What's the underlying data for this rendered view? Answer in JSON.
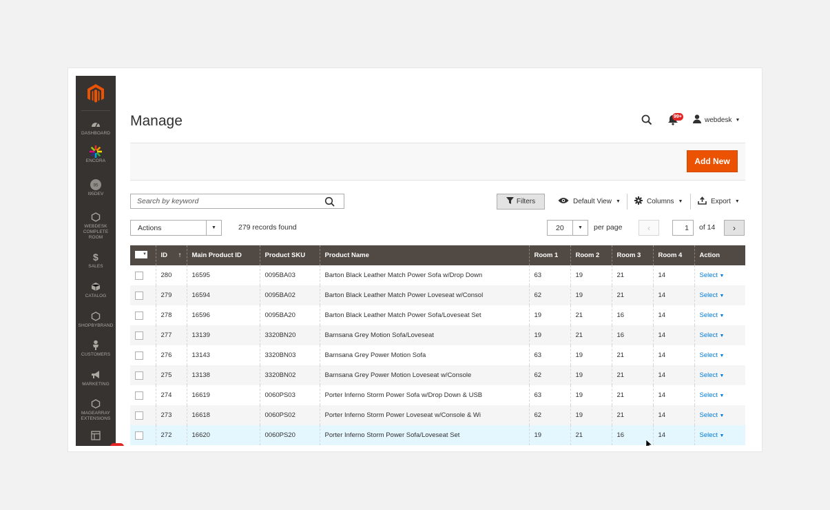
{
  "sidebar": {
    "items": [
      {
        "label": "DASHBOARD",
        "icon": "dashboard-icon"
      },
      {
        "label": "ENCORA",
        "icon": "encora-icon"
      },
      {
        "label": "I95DEV",
        "icon": "i95dev-icon"
      },
      {
        "label": "WEBDESK COMPLETE ROOM",
        "icon": "hexagon-icon"
      },
      {
        "label": "SALES",
        "icon": "dollar-icon"
      },
      {
        "label": "CATALOG",
        "icon": "cube-icon"
      },
      {
        "label": "SHOPBYBRAND",
        "icon": "hexagon-icon"
      },
      {
        "label": "CUSTOMERS",
        "icon": "person-icon"
      },
      {
        "label": "MARKETING",
        "icon": "megaphone-icon"
      },
      {
        "label": "MAGEARRAY EXTENSIONS",
        "icon": "hexagon-icon"
      },
      {
        "label": "",
        "icon": "layout-icon"
      }
    ]
  },
  "header": {
    "title": "Manage",
    "notification_count": "99+",
    "user": "webdesk"
  },
  "action_bar": {
    "add_new": "Add New"
  },
  "toolbar": {
    "search_placeholder": "Search by keyword",
    "filters": "Filters",
    "view": "Default View",
    "columns": "Columns",
    "export": "Export",
    "actions": "Actions",
    "records": "279 records found",
    "per_page_value": "20",
    "per_page_label": "per page",
    "page": "1",
    "page_of": "of 14"
  },
  "table": {
    "columns": [
      "ID",
      "Main Product ID",
      "Product SKU",
      "Product Name",
      "Room 1",
      "Room 2",
      "Room 3",
      "Room 4",
      "Action"
    ],
    "rows": [
      [
        "280",
        "16595",
        "0095BA03",
        "Barton Black Leather Match Power Sofa w/Drop Down",
        "63",
        "19",
        "21",
        "14",
        "Select"
      ],
      [
        "279",
        "16594",
        "0095BA02",
        "Barton Black Leather Match Power Loveseat w/Consol",
        "62",
        "19",
        "21",
        "14",
        "Select"
      ],
      [
        "278",
        "16596",
        "0095BA20",
        "Barton Black Leather Match Power Sofa/Loveseat Set",
        "19",
        "21",
        "16",
        "14",
        "Select"
      ],
      [
        "277",
        "13139",
        "3320BN20",
        "Barnsana Grey Motion Sofa/Loveseat",
        "19",
        "21",
        "16",
        "14",
        "Select"
      ],
      [
        "276",
        "13143",
        "3320BN03",
        "Barnsana Grey Power Motion Sofa",
        "63",
        "19",
        "21",
        "14",
        "Select"
      ],
      [
        "275",
        "13138",
        "3320BN02",
        "Barnsana Grey Power Motion Loveseat w/Console",
        "62",
        "19",
        "21",
        "14",
        "Select"
      ],
      [
        "274",
        "16619",
        "0060PS03",
        "Porter Inferno Storm Power Sofa w/Drop Down & USB",
        "63",
        "19",
        "21",
        "14",
        "Select"
      ],
      [
        "273",
        "16618",
        "0060PS02",
        "Porter Inferno Storm Power Loveseat w/Console & Wi",
        "62",
        "19",
        "21",
        "14",
        "Select"
      ],
      [
        "272",
        "16620",
        "0060PS20",
        "Porter Inferno Storm Power Sofa/Loveseat Set",
        "19",
        "21",
        "16",
        "14",
        "Select"
      ]
    ]
  },
  "colors": {
    "sidebar_bg": "#373330",
    "header_row_bg": "#514943",
    "accent": "#eb5202",
    "link": "#007bdb"
  }
}
